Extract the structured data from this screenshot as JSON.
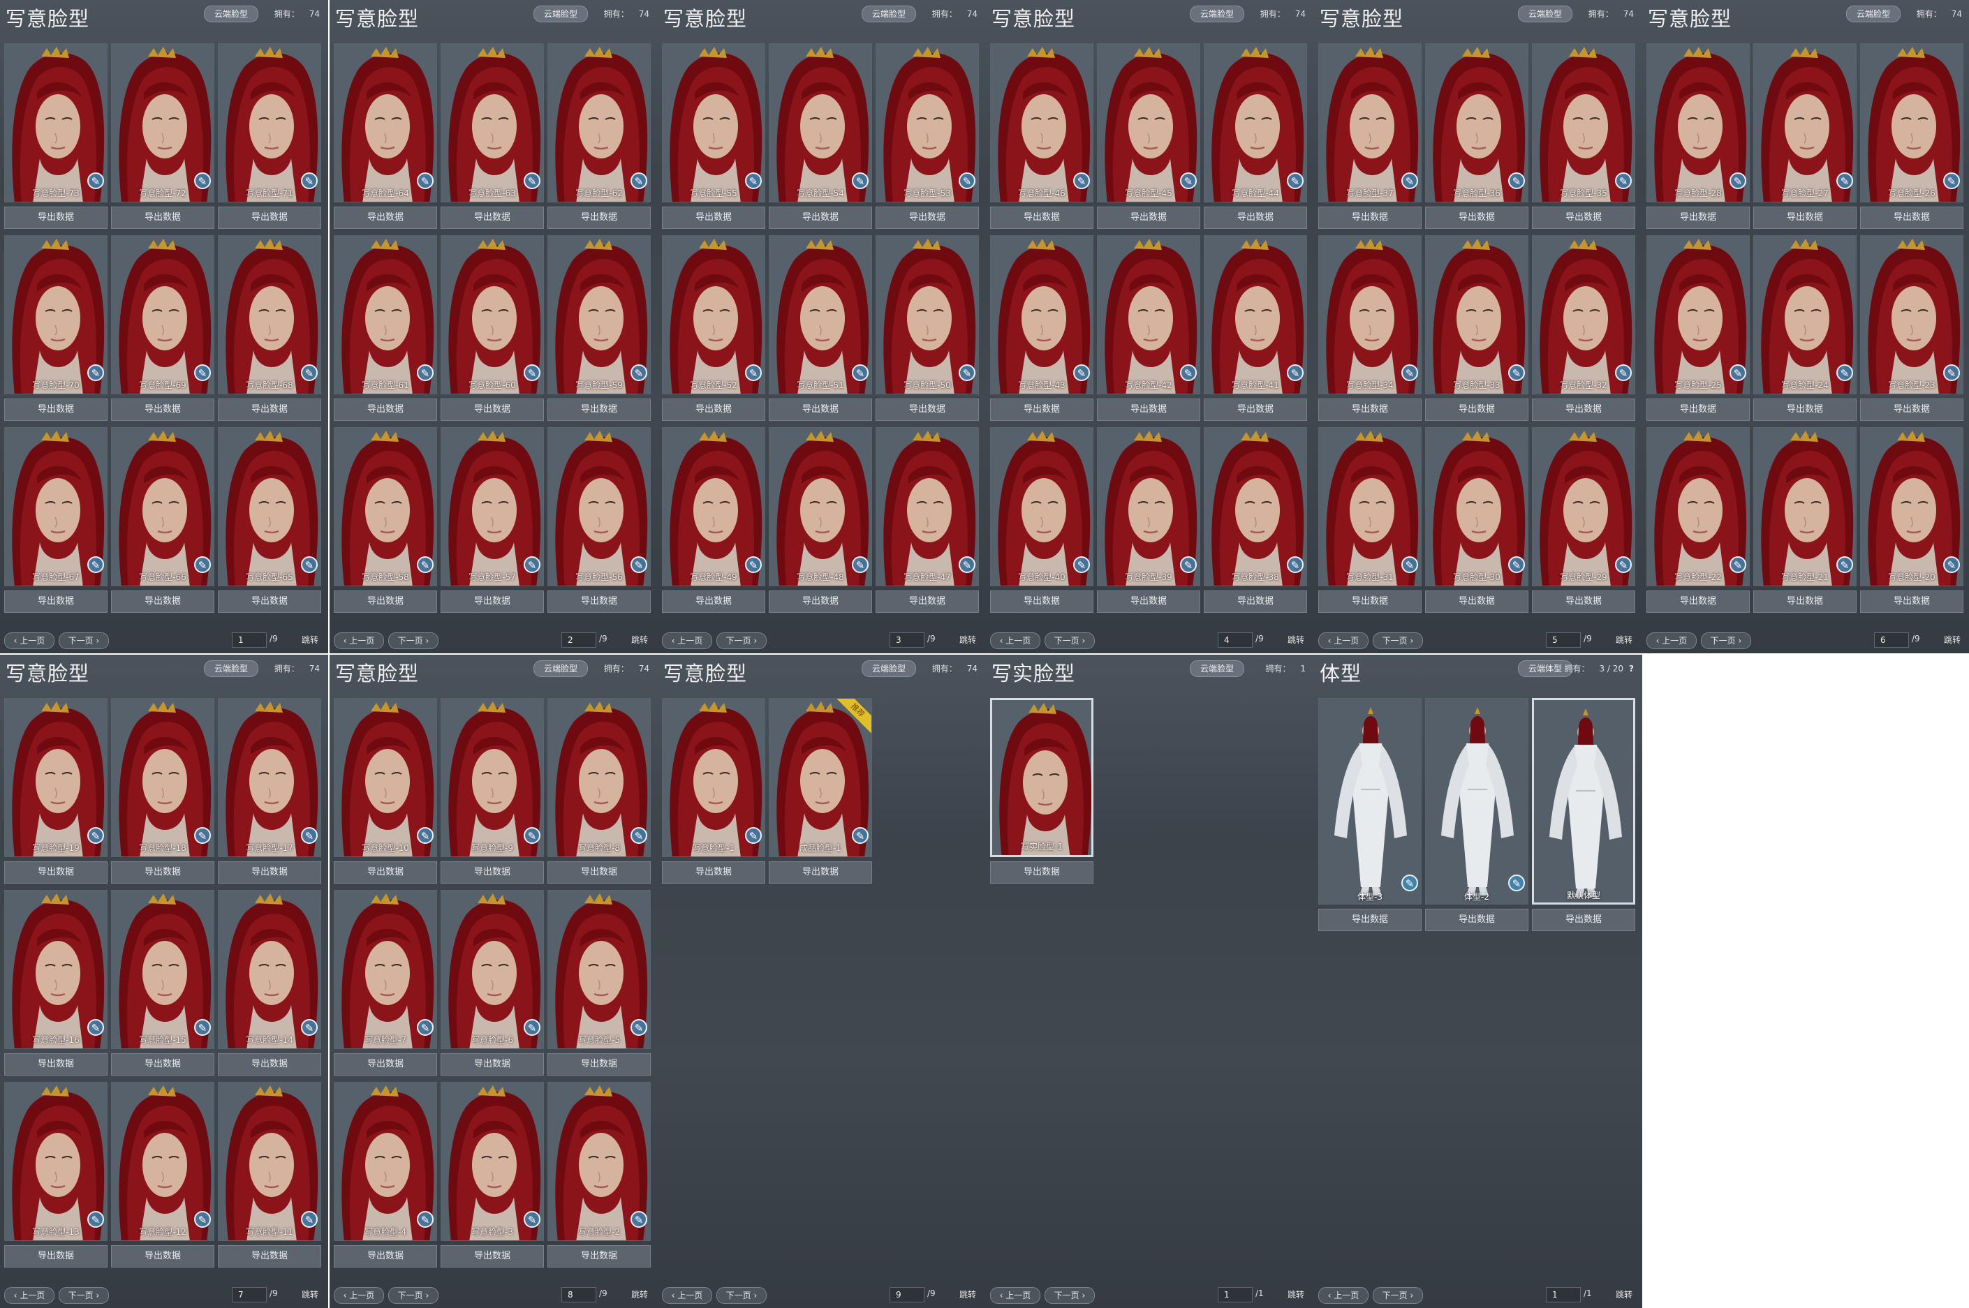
{
  "panels": [
    {
      "title": "写意脸型",
      "cloud_label": "云端脸型",
      "owned_label": "拥有：",
      "owned_value": "74",
      "kind": "face",
      "selected": -1,
      "cards": [
        {
          "label": "写意脸型-73"
        },
        {
          "label": "写意脸型-72"
        },
        {
          "label": "写意脸型-71"
        },
        {
          "label": "写意脸型-70"
        },
        {
          "label": "写意脸型-69"
        },
        {
          "label": "写意脸型-68"
        },
        {
          "label": "写意脸型-67"
        },
        {
          "label": "写意脸型-66"
        },
        {
          "label": "写意脸型-65"
        }
      ],
      "page": "1",
      "total": "/9"
    },
    {
      "title": "写意脸型",
      "cloud_label": "云端脸型",
      "owned_label": "拥有：",
      "owned_value": "74",
      "kind": "face",
      "selected": -1,
      "cards": [
        {
          "label": "写意脸型-64"
        },
        {
          "label": "写意脸型-63"
        },
        {
          "label": "写意脸型-62"
        },
        {
          "label": "写意脸型-61"
        },
        {
          "label": "写意脸型-60"
        },
        {
          "label": "写意脸型-59"
        },
        {
          "label": "写意脸型-58"
        },
        {
          "label": "写意脸型-57"
        },
        {
          "label": "写意脸型-56"
        }
      ],
      "page": "2",
      "total": "/9"
    },
    {
      "title": "写意脸型",
      "cloud_label": "云端脸型",
      "owned_label": "拥有：",
      "owned_value": "74",
      "kind": "face",
      "selected": -1,
      "cards": [
        {
          "label": "写意脸型-55"
        },
        {
          "label": "写意脸型-54"
        },
        {
          "label": "写意脸型-53"
        },
        {
          "label": "写意脸型-52"
        },
        {
          "label": "写意脸型-51"
        },
        {
          "label": "写意脸型-50"
        },
        {
          "label": "写意脸型-49"
        },
        {
          "label": "写意脸型-48"
        },
        {
          "label": "写意脸型-47"
        }
      ],
      "page": "3",
      "total": "/9"
    },
    {
      "title": "写意脸型",
      "cloud_label": "云端脸型",
      "owned_label": "拥有：",
      "owned_value": "74",
      "kind": "face",
      "selected": -1,
      "cards": [
        {
          "label": "写意脸型-46"
        },
        {
          "label": "写意脸型-45"
        },
        {
          "label": "写意脸型-44"
        },
        {
          "label": "写意脸型-43"
        },
        {
          "label": "写意脸型-42"
        },
        {
          "label": "写意脸型-41"
        },
        {
          "label": "写意脸型-40"
        },
        {
          "label": "写意脸型-39"
        },
        {
          "label": "写意脸型-38"
        }
      ],
      "page": "4",
      "total": "/9"
    },
    {
      "title": "写意脸型",
      "cloud_label": "云端脸型",
      "owned_label": "拥有：",
      "owned_value": "74",
      "kind": "face",
      "selected": -1,
      "cards": [
        {
          "label": "写意脸型-37"
        },
        {
          "label": "写意脸型-36"
        },
        {
          "label": "写意脸型-35"
        },
        {
          "label": "写意脸型-34"
        },
        {
          "label": "写意脸型-33"
        },
        {
          "label": "写意脸型-32"
        },
        {
          "label": "写意脸型-31"
        },
        {
          "label": "写意脸型-30"
        },
        {
          "label": "写意脸型-29"
        }
      ],
      "page": "5",
      "total": "/9"
    },
    {
      "title": "写意脸型",
      "cloud_label": "云端脸型",
      "owned_label": "拥有：",
      "owned_value": "74",
      "kind": "face",
      "selected": -1,
      "cards": [
        {
          "label": "写意脸型-28"
        },
        {
          "label": "写意脸型-27"
        },
        {
          "label": "写意脸型-26"
        },
        {
          "label": "写意脸型-25"
        },
        {
          "label": "写意脸型-24"
        },
        {
          "label": "写意脸型-23"
        },
        {
          "label": "写意脸型-22"
        },
        {
          "label": "写意脸型-21"
        },
        {
          "label": "写意脸型-20"
        }
      ],
      "page": "6",
      "total": "/9"
    },
    {
      "title": "写意脸型",
      "cloud_label": "云端脸型",
      "owned_label": "拥有：",
      "owned_value": "74",
      "kind": "face",
      "selected": -1,
      "cards": [
        {
          "label": "写意脸型-19"
        },
        {
          "label": "写意脸型-18"
        },
        {
          "label": "写意脸型-17"
        },
        {
          "label": "写意脸型-16"
        },
        {
          "label": "写意脸型-15"
        },
        {
          "label": "写意脸型-14"
        },
        {
          "label": "写意脸型-13"
        },
        {
          "label": "写意脸型-12"
        },
        {
          "label": "写意脸型-11"
        }
      ],
      "page": "7",
      "total": "/9"
    },
    {
      "title": "写意脸型",
      "cloud_label": "云端脸型",
      "owned_label": "拥有：",
      "owned_value": "74",
      "kind": "face",
      "selected": -1,
      "cards": [
        {
          "label": "写意脸型-10"
        },
        {
          "label": "写意脸型-9"
        },
        {
          "label": "写意脸型-8"
        },
        {
          "label": "写意脸型-7"
        },
        {
          "label": "写意脸型-6"
        },
        {
          "label": "写意脸型-5"
        },
        {
          "label": "写意脸型-4"
        },
        {
          "label": "写意脸型-3"
        },
        {
          "label": "写意脸型-2"
        }
      ],
      "page": "8",
      "total": "/9"
    },
    {
      "title": "写意脸型",
      "cloud_label": "云端脸型",
      "owned_label": "拥有：",
      "owned_value": "74",
      "kind": "face",
      "selected": -1,
      "cards": [
        {
          "label": "写意脸型-1"
        },
        {
          "label": "成品脸型-1",
          "tag": "推荐"
        }
      ],
      "page": "9",
      "total": "/9"
    },
    {
      "title": "写实脸型",
      "cloud_label": "云端脸型",
      "owned_label": "拥有：",
      "owned_value": "1",
      "kind": "face",
      "selected": 0,
      "cards": [
        {
          "label": "写实脸型-1"
        }
      ],
      "page": "1",
      "total": "/1"
    },
    {
      "title": "体型",
      "cloud_label": "云端体型",
      "owned_label": "拥有：",
      "owned_value": "3 / 20",
      "help": "?",
      "kind": "body",
      "selected": 2,
      "cards": [
        {
          "label": "体型-3"
        },
        {
          "label": "体型-2"
        },
        {
          "label": "默认体型"
        }
      ],
      "page": "1",
      "total": "/1"
    }
  ],
  "common": {
    "export_label": "导出数据",
    "prev_label": "上一页",
    "next_label": "下一页",
    "jump_label": "跳转",
    "badge_icon": "pencil-icon"
  },
  "colors": {
    "panel_bg": "#3f464d",
    "hair": "#7d0f14",
    "skin": "#d8b7a3",
    "accent_badge": "#3c8cb9",
    "tag_gold": "#e1bf2a"
  }
}
